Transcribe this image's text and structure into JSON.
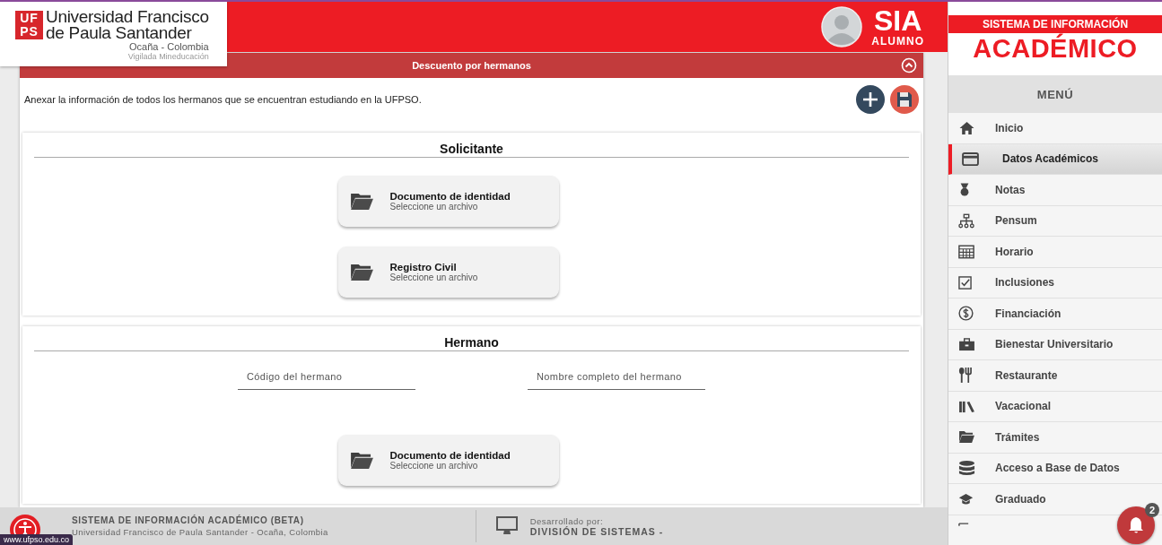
{
  "header": {
    "logo": {
      "mark_top": "UF",
      "mark_bottom": "PS",
      "line1": "Universidad Francisco",
      "line2": "de Paula Santander",
      "line3": "Ocaña - Colombia",
      "line4": "Vigilada Mineducación"
    },
    "app": "SIA",
    "role": "ALUMNO"
  },
  "panel": {
    "title": "Descuento por hermanos",
    "description": "Anexar la información de todos los hermanos que se encuentran estudiando en la UFPSO.",
    "sections": [
      {
        "title": "Solicitante",
        "files": [
          {
            "label": "Documento de identidad",
            "hint": "Seleccione un archivo"
          },
          {
            "label": "Registro Civil",
            "hint": "Seleccione un archivo"
          }
        ]
      },
      {
        "title": "Hermano",
        "fields": [
          {
            "placeholder": "Código del hermano"
          },
          {
            "placeholder": "Nombre completo del hermano"
          }
        ],
        "files": [
          {
            "label": "Documento de identidad",
            "hint": "Seleccione un archivo"
          }
        ]
      }
    ]
  },
  "footer": {
    "title": "SISTEMA DE INFORMACIÓN ACADÉMICO (BETA)",
    "subtitle": "Universidad Francisco de Paula Santander - Ocaña, Colombia",
    "dev_label": "Desarrollado por:",
    "dev_name": "DIVISIÓN DE SISTEMAS -"
  },
  "status_link": "www.ufpso.edu.co",
  "sidebar": {
    "brand_top": "SISTEMA DE INFORMACIÓN",
    "brand_main": "ACADÉMICO",
    "menu_title": "MENÚ",
    "items": [
      {
        "label": "Inicio",
        "selected": false
      },
      {
        "label": "Datos Académicos",
        "selected": true
      },
      {
        "label": "Notas",
        "selected": false
      },
      {
        "label": "Pensum",
        "selected": false
      },
      {
        "label": "Horario",
        "selected": false
      },
      {
        "label": "Inclusiones",
        "selected": false
      },
      {
        "label": "Financiación",
        "selected": false
      },
      {
        "label": "Bienestar Universitario",
        "selected": false
      },
      {
        "label": "Restaurante",
        "selected": false
      },
      {
        "label": "Vacacional",
        "selected": false
      },
      {
        "label": "Trámites",
        "selected": false
      },
      {
        "label": "Acceso a Base de Datos",
        "selected": false
      },
      {
        "label": "Graduado",
        "selected": false
      }
    ]
  },
  "notifications": {
    "count": "2"
  }
}
